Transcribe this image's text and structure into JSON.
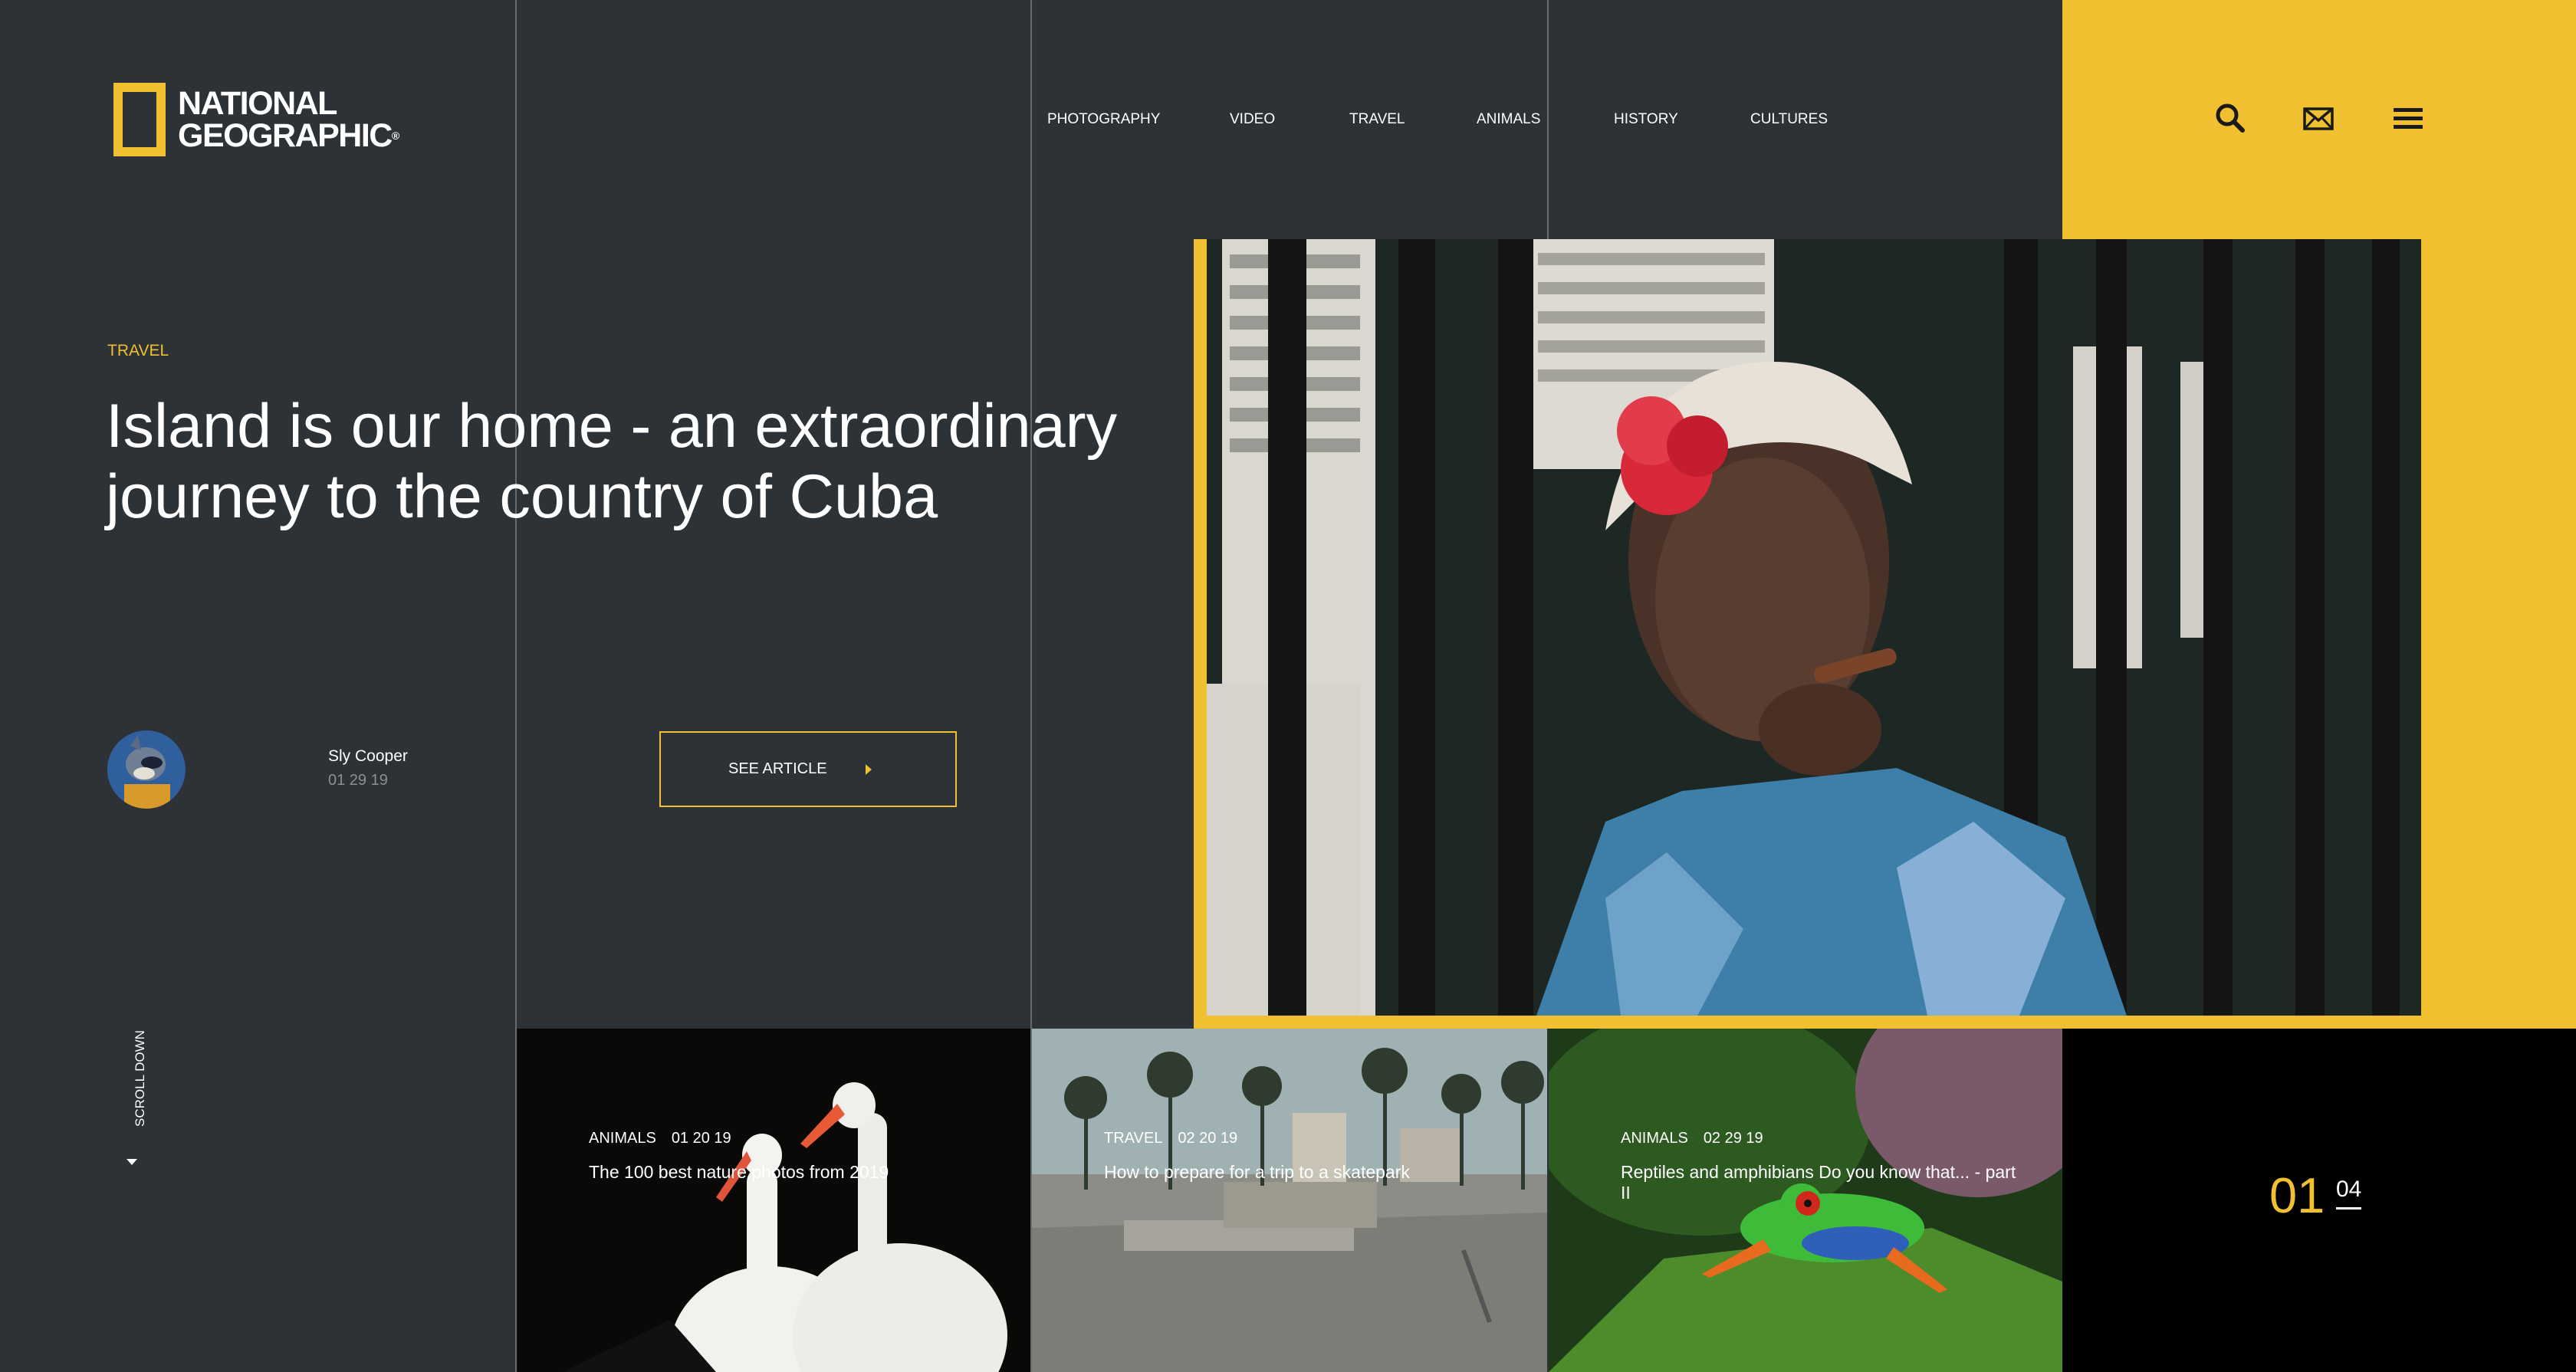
{
  "brand": {
    "name_line1": "NATIONAL",
    "name_line2": "GEOGRAPHIC",
    "registered": "®",
    "accent_color": "#f0c030",
    "background_color": "#2c3235"
  },
  "nav": {
    "items": [
      "PHOTOGRAPHY",
      "VIDEO",
      "TRAVEL",
      "ANIMALS",
      "HISTORY",
      "CULTURES"
    ]
  },
  "header_icons": [
    "search-icon",
    "mail-icon",
    "menu-icon"
  ],
  "hero": {
    "category": "TRAVEL",
    "title": "Island is our home - an extraordinary journey to the country of Cuba",
    "author": "Sly Cooper",
    "date": "01 29 19",
    "cta_label": "SEE ARTICLE"
  },
  "scroll_label": "SCROLL DOWN",
  "cards": [
    {
      "category": "ANIMALS",
      "date": "01 20 19",
      "title": "The 100 best nature photos from 2019"
    },
    {
      "category": "TRAVEL",
      "date": "02 20 19",
      "title": "How to prepare for a trip to a skatepark"
    },
    {
      "category": "ANIMALS",
      "date": "02 29 19",
      "title": "Reptiles and amphibians Do you know that... - part II"
    }
  ],
  "pager": {
    "current": "01",
    "total": "04"
  }
}
